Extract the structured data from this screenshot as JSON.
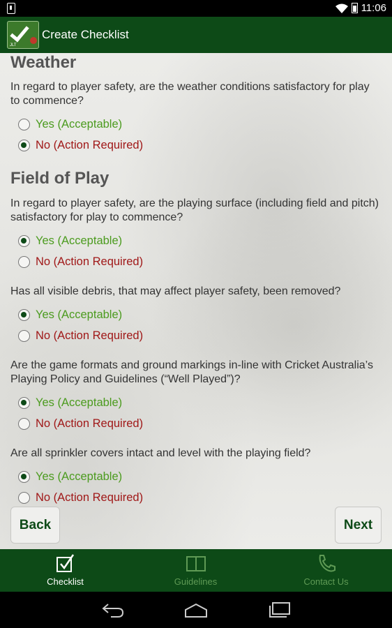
{
  "status_bar": {
    "time": "11:06"
  },
  "action_bar": {
    "title": "Create Checklist",
    "logo_text": "JLT"
  },
  "sections": [
    {
      "title": "Weather"
    },
    {
      "title": "Field of Play"
    }
  ],
  "questions": [
    {
      "text": "In regard to player safety, are the weather conditions satisfactory for play to commence?",
      "selected": "no"
    },
    {
      "text": "In regard to player safety, are the playing surface (including field and pitch) satisfactory for play to commence?",
      "selected": "yes"
    },
    {
      "text": "Has all visible debris, that may affect player safety, been removed?",
      "selected": "yes"
    },
    {
      "text": "Are the game formats and ground markings in-line with Cricket Australia’s Playing Policy and Guidelines (“Well Played”)?",
      "selected": "yes"
    },
    {
      "text": "Are all sprinkler covers intact and level with the playing field?",
      "selected": "yes"
    }
  ],
  "options": {
    "yes": "Yes (Acceptable)",
    "no": "No (Action Required)"
  },
  "buttons": {
    "back": "Back",
    "next": "Next"
  },
  "bottom_nav": [
    {
      "label": "Checklist",
      "icon": "checklist-icon",
      "active": true
    },
    {
      "label": "Guidelines",
      "icon": "book-icon",
      "active": false
    },
    {
      "label": "Contact Us",
      "icon": "phone-icon",
      "active": false
    }
  ],
  "colors": {
    "brand_green": "#0d4a17",
    "yes_green": "#4b9b1e",
    "no_red": "#a01818"
  }
}
